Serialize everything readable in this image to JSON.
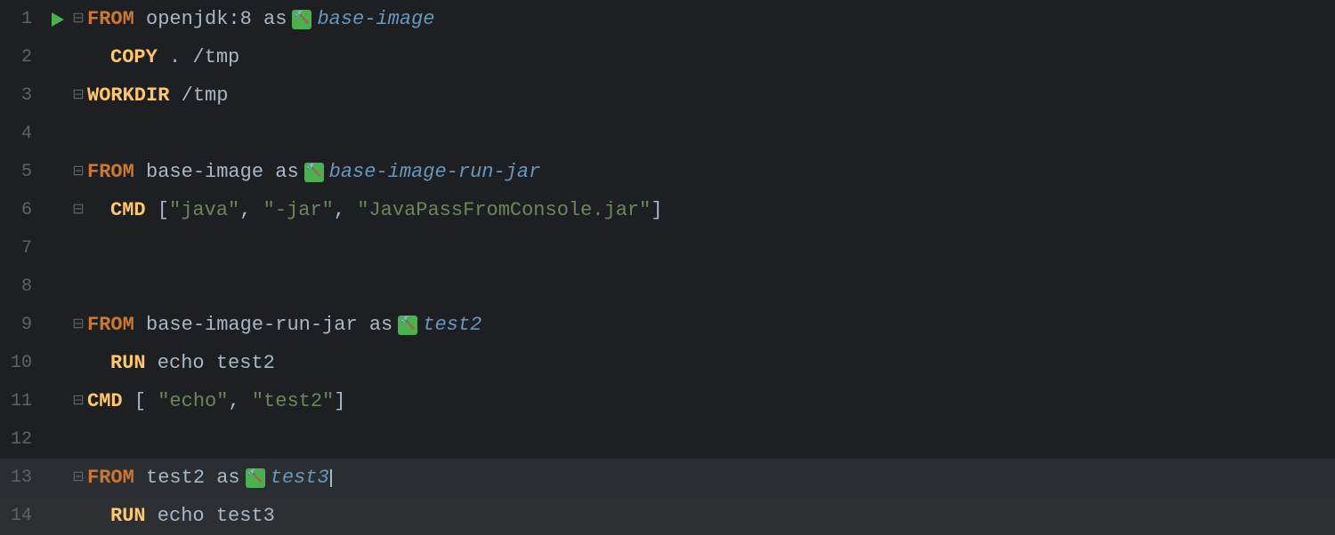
{
  "editor": {
    "background": "#1e1f22",
    "lines": [
      {
        "number": "1",
        "has_run_button": true,
        "has_fold": true,
        "indent": false,
        "parts": [
          {
            "type": "kw-from",
            "text": "FROM"
          },
          {
            "type": "text-plain",
            "text": " openjdk:8 "
          },
          {
            "type": "text-plain",
            "text": "as"
          },
          {
            "type": "hammer",
            "text": "🔨"
          },
          {
            "type": "stage-name",
            "text": "base-image"
          }
        ]
      },
      {
        "number": "2",
        "has_run_button": false,
        "has_fold": false,
        "indent": true,
        "parts": [
          {
            "type": "kw-copy",
            "text": "COPY"
          },
          {
            "type": "text-plain",
            "text": " . /tmp"
          }
        ]
      },
      {
        "number": "3",
        "has_run_button": false,
        "has_fold": true,
        "indent": false,
        "parts": [
          {
            "type": "kw-workdir",
            "text": "WORKDIR"
          },
          {
            "type": "text-plain",
            "text": " /tmp"
          }
        ]
      },
      {
        "number": "4",
        "has_run_button": false,
        "has_fold": false,
        "indent": false,
        "parts": []
      },
      {
        "number": "5",
        "has_run_button": false,
        "has_fold": true,
        "indent": false,
        "parts": [
          {
            "type": "kw-from",
            "text": "FROM"
          },
          {
            "type": "text-plain",
            "text": " base-image "
          },
          {
            "type": "text-plain",
            "text": "as"
          },
          {
            "type": "hammer",
            "text": "🔨"
          },
          {
            "type": "stage-name",
            "text": "base-image-run-jar"
          }
        ]
      },
      {
        "number": "6",
        "has_run_button": false,
        "has_fold": true,
        "indent": true,
        "parts": [
          {
            "type": "kw-cmd",
            "text": "CMD"
          },
          {
            "type": "text-plain",
            "text": " ["
          },
          {
            "type": "string-val",
            "text": "\"java\""
          },
          {
            "type": "text-plain",
            "text": ", "
          },
          {
            "type": "string-val",
            "text": "\"-jar\""
          },
          {
            "type": "text-plain",
            "text": ", "
          },
          {
            "type": "string-val",
            "text": "\"JavaPassFromConsole.jar\""
          },
          {
            "type": "text-plain",
            "text": "]"
          }
        ]
      },
      {
        "number": "7",
        "has_run_button": false,
        "has_fold": false,
        "indent": false,
        "parts": []
      },
      {
        "number": "8",
        "has_run_button": false,
        "has_fold": false,
        "indent": false,
        "parts": []
      },
      {
        "number": "9",
        "has_run_button": false,
        "has_fold": true,
        "indent": false,
        "parts": [
          {
            "type": "kw-from",
            "text": "FROM"
          },
          {
            "type": "text-plain",
            "text": " base-image-run-jar "
          },
          {
            "type": "text-plain",
            "text": "as"
          },
          {
            "type": "hammer",
            "text": "🔨"
          },
          {
            "type": "stage-name",
            "text": "test2"
          }
        ]
      },
      {
        "number": "10",
        "has_run_button": false,
        "has_fold": false,
        "indent": true,
        "parts": [
          {
            "type": "kw-run",
            "text": "RUN"
          },
          {
            "type": "text-plain",
            "text": " echo test2"
          }
        ]
      },
      {
        "number": "11",
        "has_run_button": false,
        "has_fold": true,
        "indent": false,
        "parts": [
          {
            "type": "kw-cmd",
            "text": "CMD"
          },
          {
            "type": "text-plain",
            "text": " [ "
          },
          {
            "type": "string-val",
            "text": "\"echo\""
          },
          {
            "type": "text-plain",
            "text": ", "
          },
          {
            "type": "string-val",
            "text": "\"test2\""
          },
          {
            "type": "text-plain",
            "text": "]"
          }
        ]
      },
      {
        "number": "12",
        "has_run_button": false,
        "has_fold": false,
        "indent": false,
        "parts": []
      },
      {
        "number": "13",
        "has_run_button": false,
        "has_fold": true,
        "indent": false,
        "is_cursor_line": true,
        "parts": [
          {
            "type": "kw-from",
            "text": "FROM"
          },
          {
            "type": "text-plain",
            "text": " test2 "
          },
          {
            "type": "text-plain",
            "text": "as"
          },
          {
            "type": "hammer",
            "text": "🔨"
          },
          {
            "type": "stage-name",
            "text": "test3"
          },
          {
            "type": "cursor",
            "text": ""
          }
        ]
      },
      {
        "number": "14",
        "has_run_button": false,
        "has_fold": false,
        "indent": true,
        "parts": [
          {
            "type": "kw-run",
            "text": "RUN"
          },
          {
            "type": "text-plain",
            "text": " echo test3"
          }
        ]
      }
    ]
  }
}
